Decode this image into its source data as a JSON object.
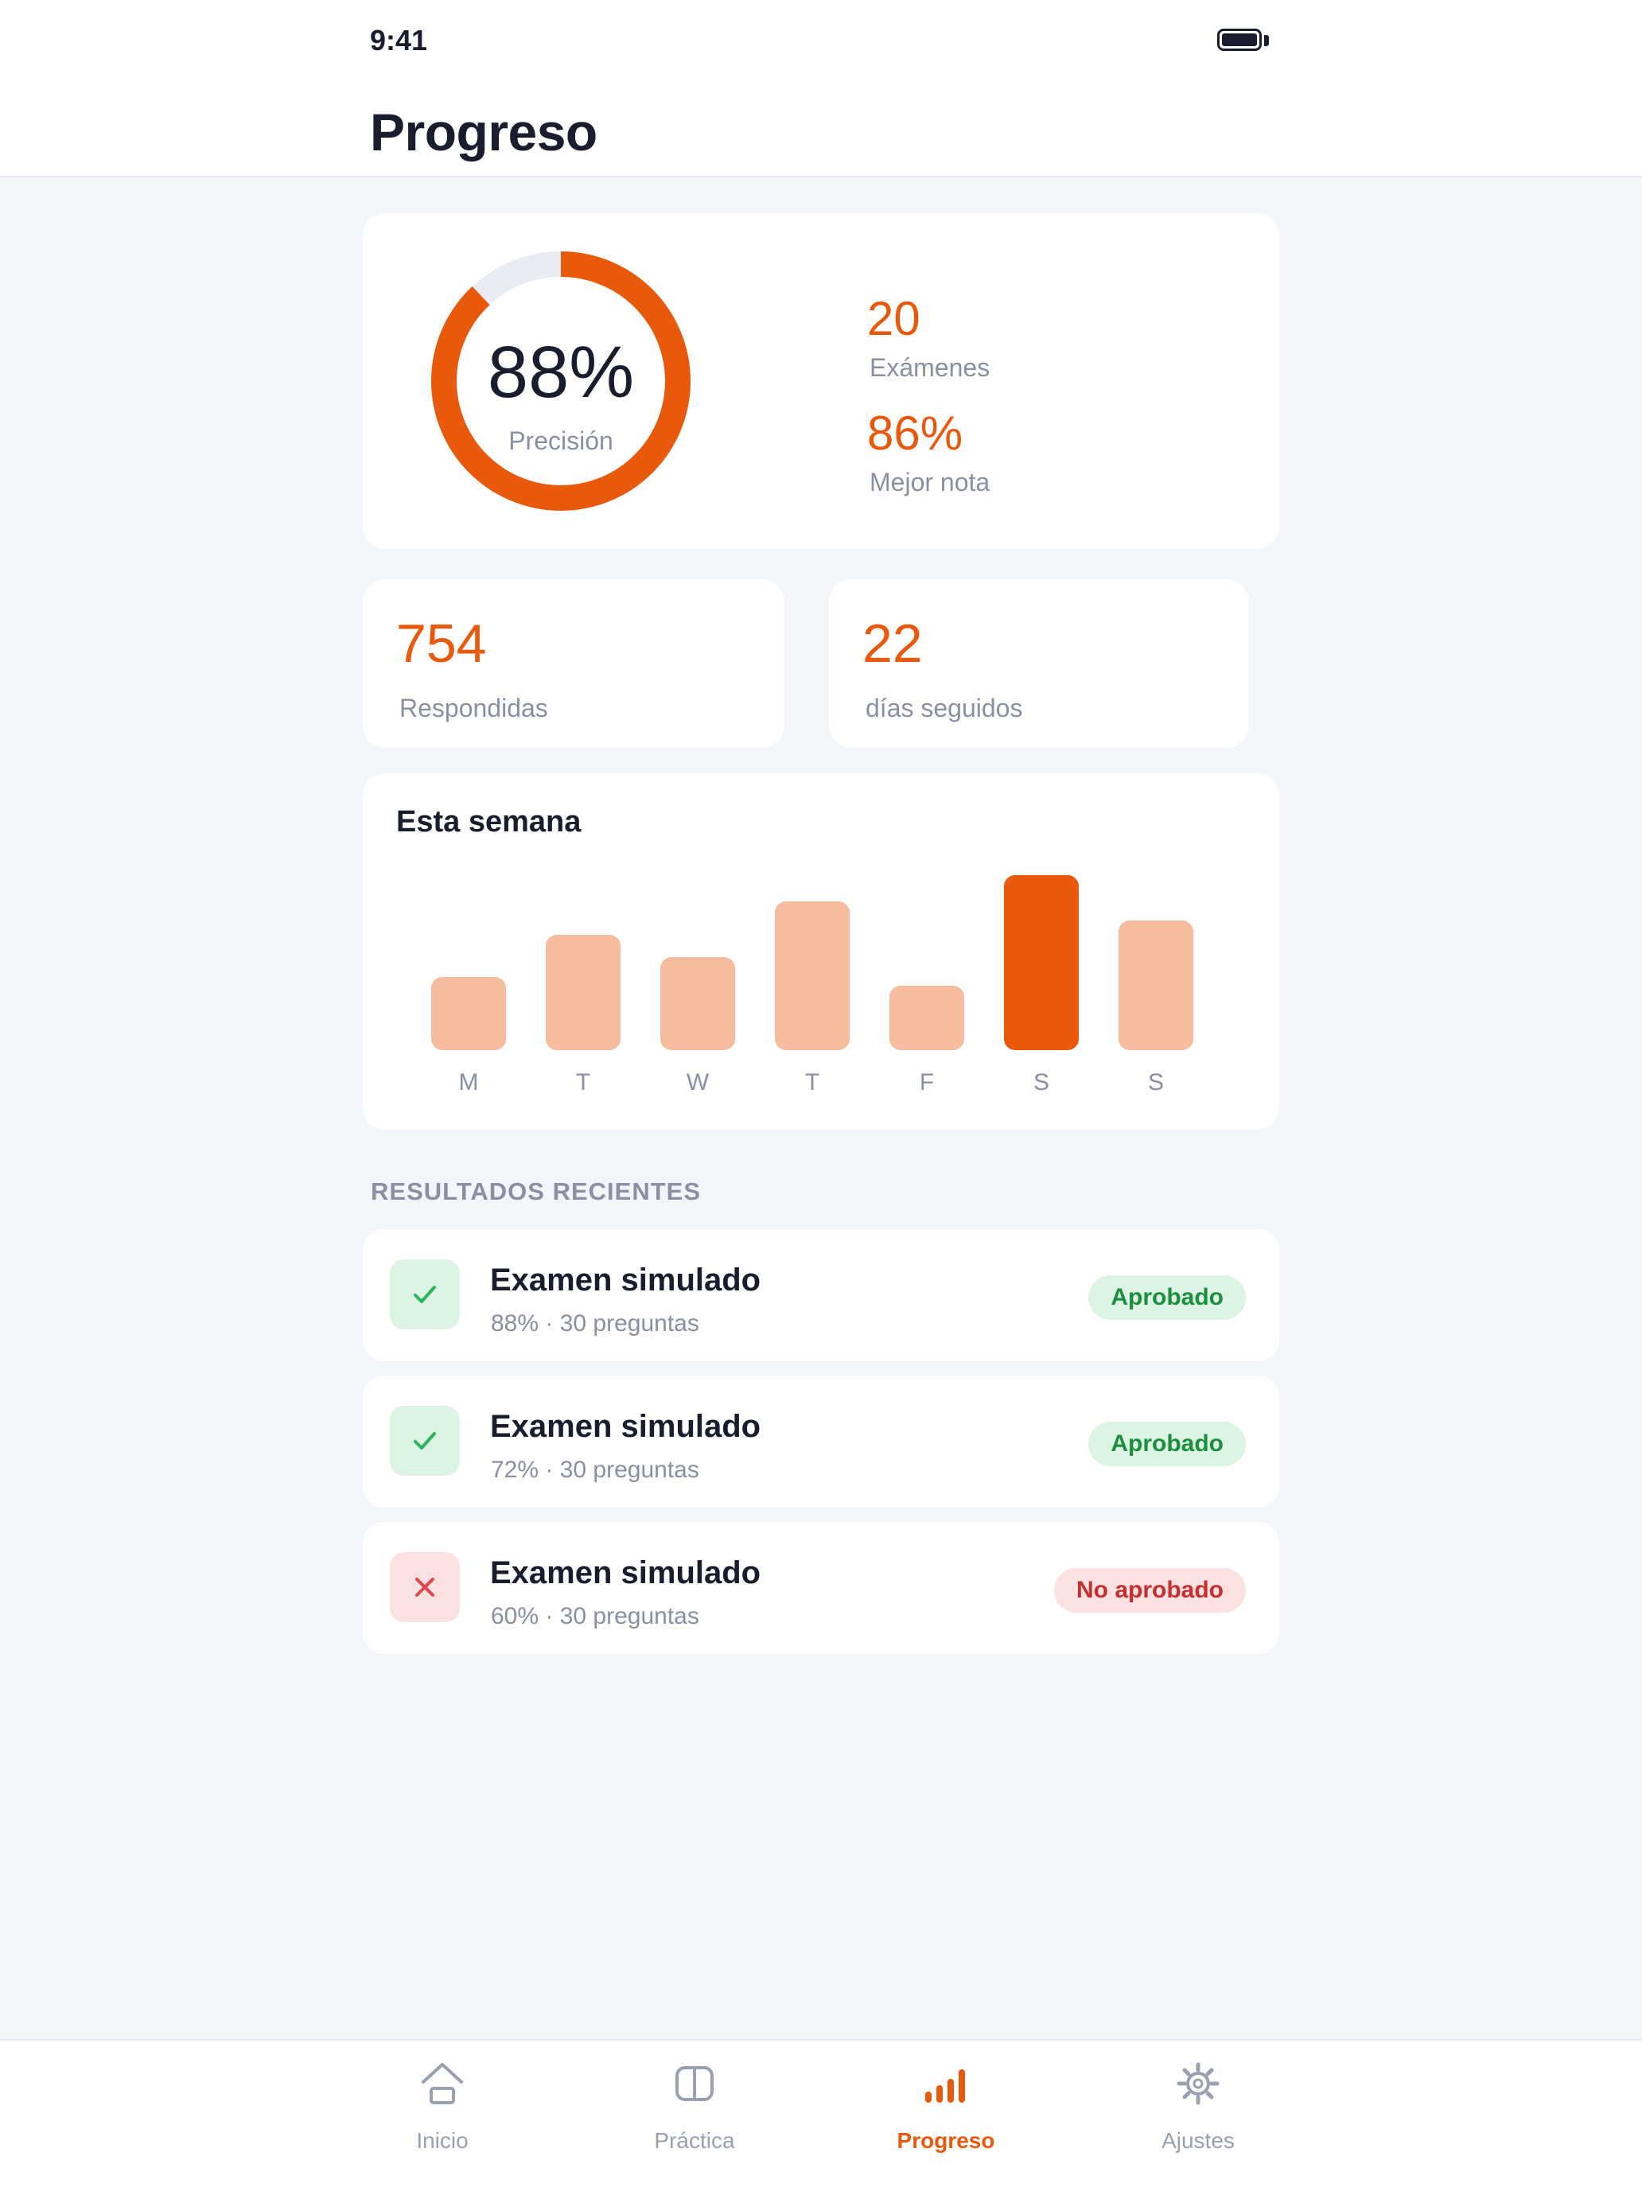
{
  "status_bar": {
    "time": "9:41"
  },
  "header": {
    "title": "Progreso"
  },
  "summary": {
    "accuracy_value": "88%",
    "accuracy_fraction": 0.88,
    "accuracy_label": "Precisión",
    "exams_value": "20",
    "exams_label": "Exámenes",
    "best_value": "86%",
    "best_label": "Mejor nota"
  },
  "stats": [
    {
      "value": "754",
      "label": "Respondidas"
    },
    {
      "value": "22",
      "label": "días seguidos"
    }
  ],
  "week": {
    "title": "Esta semana",
    "days": [
      "M",
      "T",
      "W",
      "T",
      "F",
      "S",
      "S"
    ],
    "relative_levels": [
      0.42,
      0.66,
      0.53,
      0.85,
      0.37,
      1.0,
      0.74
    ],
    "active_index": 5
  },
  "recent": {
    "section_label": "RESULTADOS RECIENTES",
    "items": [
      {
        "title": "Examen simulado",
        "subtitle": "88% · 30 preguntas",
        "status": "Aprobado",
        "passed": true
      },
      {
        "title": "Examen simulado",
        "subtitle": "72% · 30 preguntas",
        "status": "Aprobado",
        "passed": true
      },
      {
        "title": "Examen simulado",
        "subtitle": "60% · 30 preguntas",
        "status": "No aprobado",
        "passed": false
      }
    ]
  },
  "tabs": [
    {
      "label": "Inicio",
      "icon": "home-icon",
      "active": false
    },
    {
      "label": "Práctica",
      "icon": "book-icon",
      "active": false
    },
    {
      "label": "Progreso",
      "icon": "bar-chart-icon",
      "active": true
    },
    {
      "label": "Ajustes",
      "icon": "gear-icon",
      "active": false
    }
  ],
  "colors": {
    "accent": "#e8590c",
    "accent_light": "#f5bd9e",
    "success": "#1c8f3f",
    "danger": "#c62f2f",
    "background": "#f2f5fa"
  }
}
